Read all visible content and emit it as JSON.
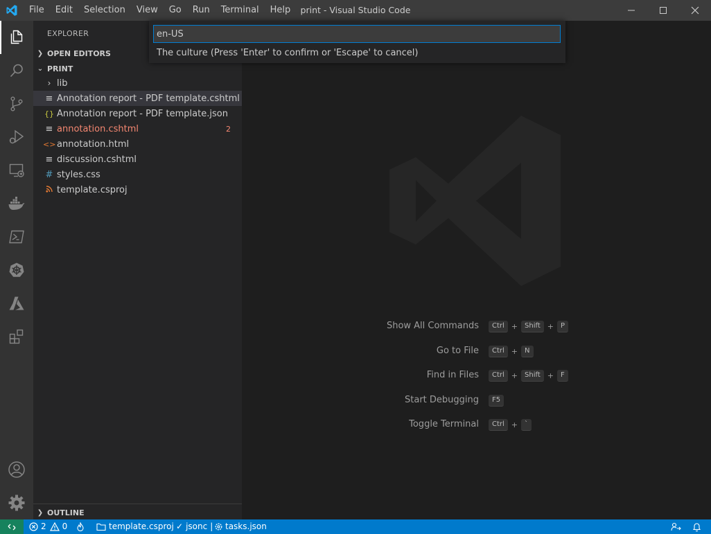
{
  "window": {
    "title": "print - Visual Studio Code"
  },
  "menubar": [
    "File",
    "Edit",
    "Selection",
    "View",
    "Go",
    "Run",
    "Terminal",
    "Help"
  ],
  "activity_bar": {
    "top": [
      "files-icon",
      "search-icon",
      "source-control-icon",
      "run-debug-icon",
      "remote-explorer-icon",
      "docker-icon",
      "powershell-icon",
      "kubernetes-icon",
      "azure-icon",
      "extensions-icon"
    ],
    "bottom": [
      "account-icon",
      "manage-gear-icon"
    ]
  },
  "sidebar": {
    "title": "EXPLORER",
    "open_editors_label": "OPEN EDITORS",
    "folder_label": "PRINT",
    "items": [
      {
        "name": "lib",
        "icon": ">",
        "color": "#cccccc",
        "badge": ""
      },
      {
        "name": "Annotation report - PDF template.cshtml",
        "icon": "≡",
        "color": "#cccccc",
        "badge": ""
      },
      {
        "name": "Annotation report - PDF template.json",
        "icon": "{}",
        "color": "#cccccc",
        "badge": ""
      },
      {
        "name": "annotation.cshtml",
        "icon": "≡",
        "color": "#f48771",
        "badge": "2"
      },
      {
        "name": "annotation.html",
        "icon": "<>",
        "color": "#cccccc",
        "badge": ""
      },
      {
        "name": "discussion.cshtml",
        "icon": "≡",
        "color": "#cccccc",
        "badge": ""
      },
      {
        "name": "styles.css",
        "icon": "#",
        "color": "#cccccc",
        "badge": ""
      },
      {
        "name": "template.csproj",
        "icon": "rss",
        "color": "#cccccc",
        "badge": ""
      }
    ],
    "outline_label": "OUTLINE"
  },
  "quick_input": {
    "value": "en-US",
    "message": "The culture (Press 'Enter' to confirm or 'Escape' to cancel)"
  },
  "shortcuts": [
    {
      "label": "Show All Commands",
      "keys": [
        "Ctrl",
        "Shift",
        "P"
      ]
    },
    {
      "label": "Go to File",
      "keys": [
        "Ctrl",
        "N"
      ]
    },
    {
      "label": "Find in Files",
      "keys": [
        "Ctrl",
        "Shift",
        "F"
      ]
    },
    {
      "label": "Start Debugging",
      "keys": [
        "F5"
      ]
    },
    {
      "label": "Toggle Terminal",
      "keys": [
        "Ctrl",
        "`"
      ]
    }
  ],
  "statusbar": {
    "errors": "2",
    "warnings": "0",
    "project": "template.csproj",
    "language": "jsonc",
    "separator": "|",
    "task_file": "tasks.json"
  },
  "colors": {
    "accent": "#007acc",
    "remote": "#16825d",
    "error_file": "#f48771",
    "json_icon": "#cbcb41",
    "html_icon": "#e37933",
    "css_icon": "#519aba"
  }
}
